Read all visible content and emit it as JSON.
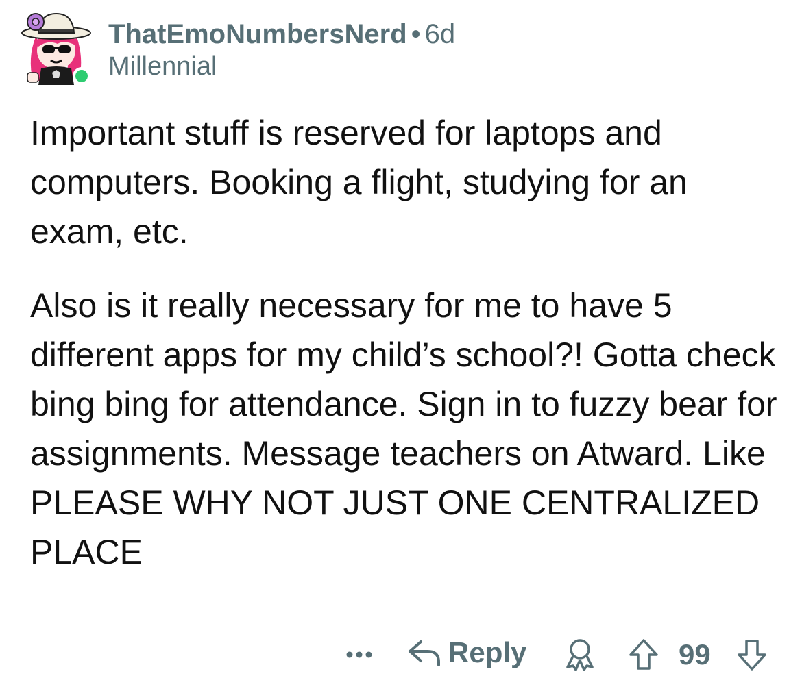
{
  "comment": {
    "author": "ThatEmoNumbersNerd",
    "separator": "•",
    "age": "6d",
    "flair": "Millennial",
    "paragraphs": [
      "Important stuff is reserved for laptops and computers. Booking a flight, studying for an exam, etc.",
      "Also is it really necessary for me to have 5 different apps for my child’s school?! Gotta check bing bing for attendance. Sign in to fuzzy bear for assignments. Message teachers on Atward. Like PLEASE WHY NOT JUST ONE CENTRALIZED PLACE"
    ]
  },
  "actions": {
    "more_icon": "ellipsis-icon",
    "reply_icon": "reply-arrow-icon",
    "reply_label": "Reply",
    "award_icon": "award-icon",
    "upvote_icon": "upvote-arrow-icon",
    "score": "99",
    "downvote_icon": "downvote-arrow-icon"
  },
  "colors": {
    "meta_gray": "#576f76",
    "online_green": "#2ecc71",
    "avatar_hair": "#e8317a",
    "body_text": "#111111"
  }
}
